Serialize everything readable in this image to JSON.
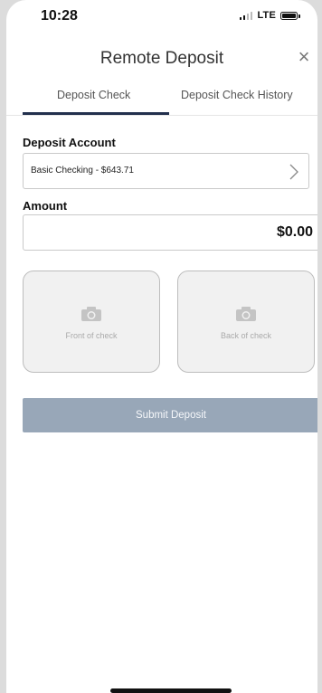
{
  "status": {
    "time": "10:28",
    "network": "LTE"
  },
  "header": {
    "title": "Remote Deposit",
    "close_label": "×"
  },
  "tabs": [
    {
      "label": "Deposit Check",
      "active": true
    },
    {
      "label": "Deposit Check History",
      "active": false
    }
  ],
  "form": {
    "account_label": "Deposit Account",
    "account_value": "Basic Checking - $643.71",
    "amount_label": "Amount",
    "amount_value": "$0.00",
    "front_label": "Front of check",
    "back_label": "Back of check",
    "submit_label": "Submit Deposit"
  },
  "icons": {
    "camera": "camera-icon",
    "chevron": "chevron-right-icon",
    "close": "close-icon"
  },
  "colors": {
    "tab_indicator": "#22304d",
    "submit_disabled": "#98a7b8"
  }
}
